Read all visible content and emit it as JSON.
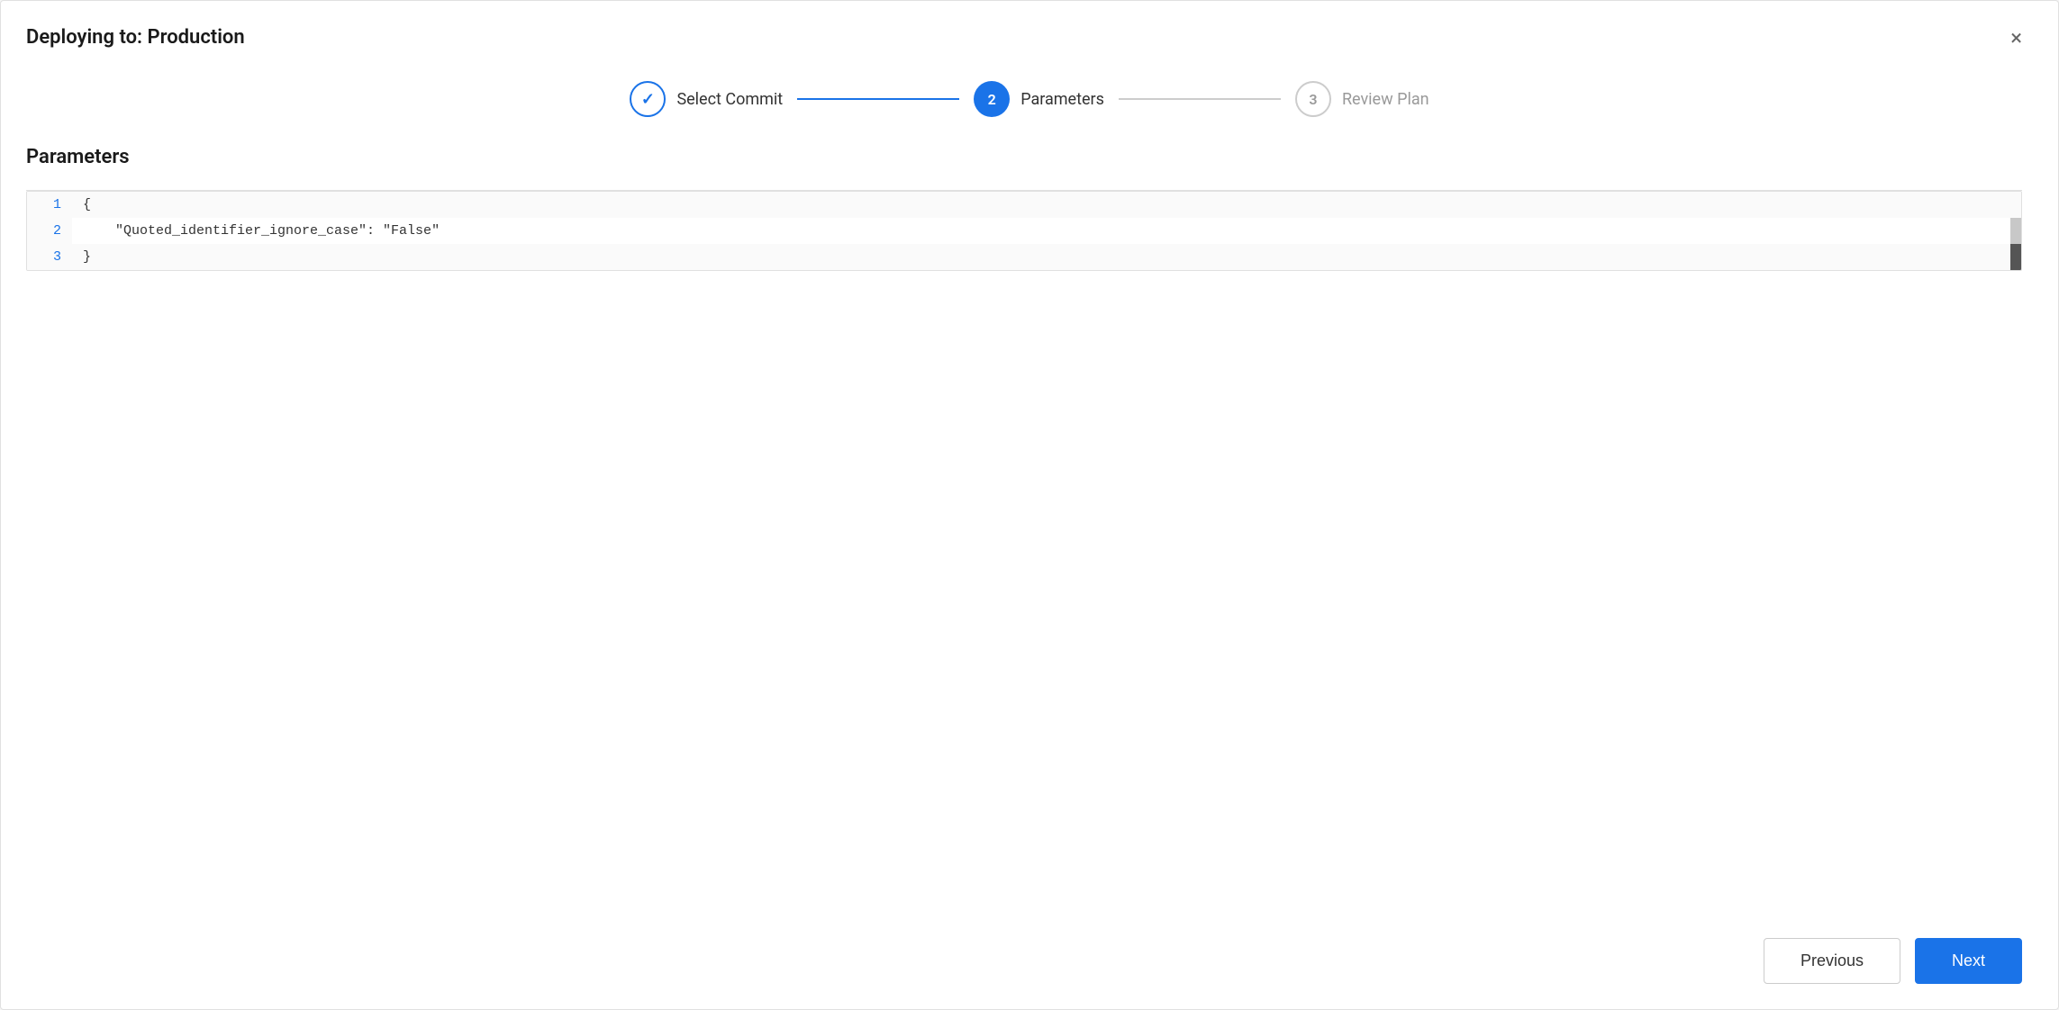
{
  "modal": {
    "title": "Deploying to: Production",
    "close_label": "×"
  },
  "stepper": {
    "steps": [
      {
        "id": "select-commit",
        "number": "✓",
        "label": "Select Commit",
        "state": "completed"
      },
      {
        "id": "parameters",
        "number": "2",
        "label": "Parameters",
        "state": "active"
      },
      {
        "id": "review-plan",
        "number": "3",
        "label": "Review Plan",
        "state": "inactive"
      }
    ],
    "connector1_state": "active",
    "connector2_state": "inactive"
  },
  "content": {
    "section_title": "Parameters",
    "code_lines": [
      {
        "number": "1",
        "content": "{"
      },
      {
        "number": "2",
        "content": "    \"Quoted_identifier_ignore_case\": \"False\""
      },
      {
        "number": "3",
        "content": "}"
      }
    ]
  },
  "footer": {
    "previous_label": "Previous",
    "next_label": "Next"
  }
}
